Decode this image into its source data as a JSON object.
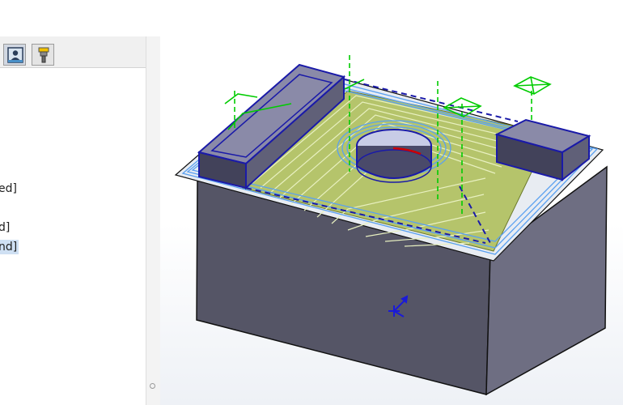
{
  "feature_tree": {
    "tabs": [
      {
        "name": "operation-tab",
        "icon": "person-frame-icon"
      },
      {
        "name": "tool-tab",
        "icon": "cutting-tool-icon"
      }
    ],
    "rows": [
      {
        "label": "ed]",
        "selected": false
      },
      {
        "label": "d]",
        "selected": false
      },
      {
        "label": "nd]",
        "selected": true
      }
    ]
  },
  "viewport": {
    "model": "machined-part-with-toolpath",
    "colors": {
      "stock_side": "#555566",
      "stock_right": "#6e6e82",
      "toolpath_fill": "#b5c46b",
      "toolpath_lines": "#e8f0c0",
      "feature_outline": "#1a1aa8",
      "pass_lines": "#5aa0f0",
      "rapid_moves": "#00cc00",
      "cut_highlight": "#cc0000"
    },
    "triad": "coordinate-triad-icon"
  }
}
